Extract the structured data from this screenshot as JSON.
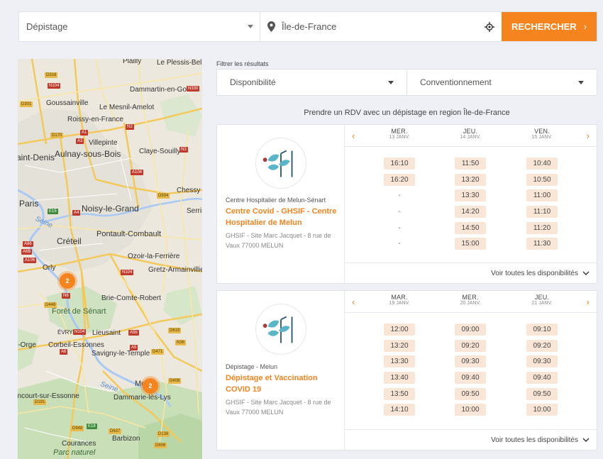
{
  "search": {
    "specialty": "Dépistage",
    "location": "Île-de-France",
    "button_label": "RECHERCHER",
    "button_chevron": "›"
  },
  "filters": {
    "label": "Filtrer les résultats",
    "availability": "Disponibilité",
    "convention": "Conventionnement"
  },
  "caption": "Prendre un RDV avec un dépistage en region Île-de-France",
  "map": {
    "labels": [
      "Le Plessis-Belleville",
      "Dammartin-en-Goële",
      "Goussainville",
      "Le Mesnil-Amelot",
      "Roissy-en-France",
      "Villepinte",
      "Aulnay-sous-Bois",
      "Claye-Souilly",
      "aint-Denis",
      "Paris",
      "Noisy-le-Grand",
      "Chessy",
      "Serris",
      "Pontault-Combault",
      "Créteil",
      "Ozoir-la-Ferrière",
      "Gretz-Armainvilliers",
      "Orly",
      "Brie-Comte-Robert",
      "Forêt de Sénart",
      "ÉVRY",
      "Lieusaint",
      "r-Orge",
      "Corbeil-Essonnes",
      "Savigny-le-Temple",
      "Me",
      "Dammarie-lès-Lys",
      "ancourt-sur-Essonne",
      "Barbizon",
      "Courances",
      "Parc naturel",
      "Seine",
      "Seine",
      "Plailly"
    ],
    "roads": [
      "D316",
      "N104",
      "N330",
      "D301",
      "A1",
      "N2",
      "D170",
      "A3",
      "N3",
      "A104",
      "D934",
      "E15",
      "A4",
      "A86",
      "A6B",
      "A106",
      "N104",
      "N6",
      "D448",
      "N104",
      "A5b",
      "D619",
      "N36",
      "A6",
      "D471",
      "D408",
      "D191",
      "D948",
      "E18",
      "D637",
      "D138",
      "D606",
      "A5"
    ],
    "clusters": [
      "2",
      "2"
    ]
  },
  "cards": [
    {
      "type": "Centre Hospitalier de Melun-Sénart",
      "name": "Centre Covid - GHSIF - Centre Hospitalier de Melun",
      "address": "GHSIF - Site Marc Jacquet - 8 rue de Vaux 77000 MELUN",
      "days": [
        {
          "name": "MER.",
          "date": "13 JANV.",
          "slots": [
            "16:10",
            "16:20",
            "-",
            "-",
            "-",
            "-"
          ]
        },
        {
          "name": "JEU.",
          "date": "14 JANV.",
          "slots": [
            "11:50",
            "13:20",
            "13:30",
            "14:20",
            "14:50",
            "15:00"
          ]
        },
        {
          "name": "VEN.",
          "date": "15 JANV.",
          "slots": [
            "10:40",
            "10:50",
            "11:00",
            "11:10",
            "11:20",
            "11:30"
          ]
        }
      ],
      "footer": "Voir toutes les disponibilités"
    },
    {
      "type": "Dépistage - Melun",
      "name": "Dépistage et Vaccination COVID 19",
      "address": "GHSIF - Site Marc Jacquet - 8 rue de Vaux 77000 MELUN",
      "days": [
        {
          "name": "MAR.",
          "date": "19 JANV.",
          "slots": [
            "12:00",
            "13:20",
            "13:30",
            "13:40",
            "13:50",
            "14:10"
          ]
        },
        {
          "name": "MER.",
          "date": "20 JANV.",
          "slots": [
            "09:00",
            "09:20",
            "09:30",
            "09:40",
            "09:50",
            "10:00"
          ]
        },
        {
          "name": "JEU.",
          "date": "21 JANV.",
          "slots": [
            "09:10",
            "09:20",
            "09:30",
            "09:40",
            "09:50",
            "10:00"
          ]
        }
      ],
      "footer": "Voir toutes les disponibilités"
    }
  ],
  "icons": {
    "prev": "chevron-left-icon",
    "next": "chevron-right-icon",
    "expand": "chevron-down-icon",
    "pin": "location-pin-icon",
    "geolocate": "crosshair-icon"
  },
  "colors": {
    "accent": "#f5841f",
    "slot_bg": "#fae6d6",
    "page_bg": "#eef0f5"
  }
}
